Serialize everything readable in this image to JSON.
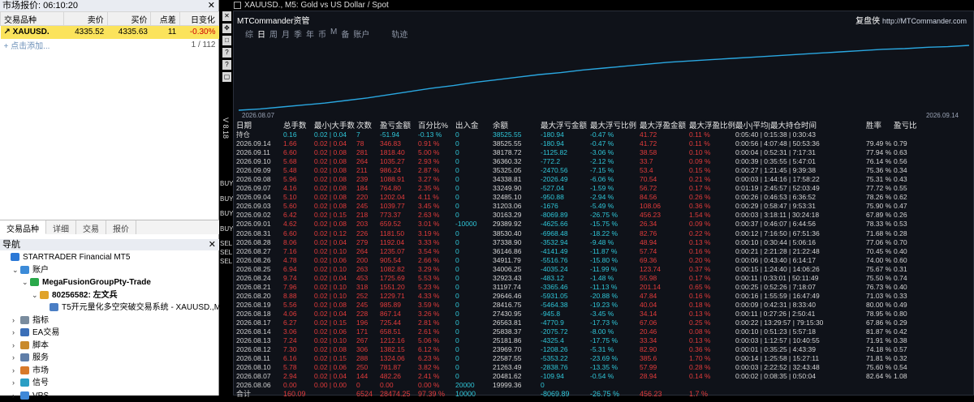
{
  "market_watch": {
    "title": "市场报价: 06:10:20",
    "columns": [
      "交易品种",
      "卖价",
      "买价",
      "点差",
      "日变化"
    ],
    "rows": [
      [
        "XAUUSD.",
        "4335.52",
        "4335.63",
        "11",
        "-0.30%"
      ]
    ],
    "add_label": "点击添加...",
    "count": "1 / 112"
  },
  "left_tabs": [
    "交易品种",
    "详细",
    "交易",
    "报价"
  ],
  "navigator": {
    "title": "导航",
    "items": [
      {
        "label": "STARTRADER Financial MT5",
        "level": 0,
        "icon": "#2b78d6",
        "bold": false
      },
      {
        "label": "账户",
        "level": 1,
        "icon": "#3c8bd8",
        "bold": false
      },
      {
        "label": "MegaFusionGroupPty-Trade",
        "level": 2,
        "icon": "#2aa84a",
        "bold": true
      },
      {
        "label": "80256582: 左文兵",
        "level": 3,
        "icon": "#e0a32a",
        "bold": true
      },
      {
        "label": "T5开元量化多空突破交易系统 - XAUUSD.,M",
        "level": 4,
        "icon": "#4a7ec4",
        "bold": false
      },
      {
        "label": "指标",
        "level": 1,
        "icon": "#7a8c9e",
        "bold": false
      },
      {
        "label": "EA交易",
        "level": 1,
        "icon": "#3b6fb8",
        "bold": false
      },
      {
        "label": "脚本",
        "level": 1,
        "icon": "#c98a2b",
        "bold": false
      },
      {
        "label": "服务",
        "level": 1,
        "icon": "#5f7ea8",
        "bold": false
      },
      {
        "label": "市场",
        "level": 1,
        "icon": "#d87a2a",
        "bold": false
      },
      {
        "label": "信号",
        "level": 1,
        "icon": "#2a9ec4",
        "bold": false
      },
      {
        "label": "VPS",
        "level": 1,
        "icon": "#3f88d8",
        "bold": false
      }
    ]
  },
  "chart_window": {
    "title": "XAUUSD., M5:  Gold vs US Dollar / Spot",
    "vertical_label": "V 8.18",
    "side_texts": [
      "BUY",
      "BUY",
      "BUY",
      "BUY",
      "SEL",
      "SEL",
      "SEL"
    ]
  },
  "panel": {
    "title": "MTCommander资管",
    "right_brand": "复盘侠",
    "right_url": "http://MTCommander.com",
    "tabs": [
      "综",
      "日",
      "周",
      "月",
      "季",
      "年",
      "币",
      "M",
      "备",
      "账户",
      "轨迹"
    ],
    "date_start": "2026.08.07",
    "date_end": "2026.09.14",
    "equity_curve": [
      0.0,
      0.02,
      0.05,
      0.08,
      0.11,
      0.15,
      0.19,
      0.24,
      0.29,
      0.34,
      0.38,
      0.43,
      0.47,
      0.51,
      0.55,
      0.58,
      0.62,
      0.65,
      0.68,
      0.71,
      0.74,
      0.76,
      0.78,
      0.8,
      0.82,
      0.84,
      0.86,
      0.88,
      0.9,
      0.92,
      0.94,
      0.95,
      0.97,
      0.98,
      1.0
    ],
    "headers": [
      "日期",
      "总手数",
      "最小|大手数",
      "次数",
      "盈亏金额",
      "百分比%",
      "出入金",
      "余额",
      "最大浮亏金额",
      "最大浮亏比例",
      "最大浮盈金额",
      "最大浮盈比例",
      "最小|平均|最大持仓时间",
      "胜率",
      "盈亏比"
    ],
    "hold_row": [
      "持仓",
      "0.16",
      "0.02 | 0.04",
      "7",
      "-51.94",
      "-0.13 %",
      "0",
      "38525.55",
      "-180.94",
      "-0.47 %",
      "41.72",
      "0.11 %",
      "0:05:40 | 0:15:38 | 0:30:43",
      "",
      ""
    ],
    "rows": [
      [
        "2026.09.14",
        "1.66",
        "0.02 | 0.04",
        "78",
        "346.83",
        "0.91 %",
        "0",
        "38525.55",
        "-180.94",
        "-0.47 %",
        "41.72",
        "0.11 %",
        "0:00:56 | 4:07:48 | 50:53:36",
        "79.49 %",
        "0.79"
      ],
      [
        "2026.09.11",
        "6.60",
        "0.02 | 0.08",
        "281",
        "1818.40",
        "5.00 %",
        "0",
        "38178.72",
        "-1125.82",
        "-3.06 %",
        "38.58",
        "0.10 %",
        "0:00:04 | 0:52:31 | 7:17:31",
        "77.94 %",
        "0.63"
      ],
      [
        "2026.09.10",
        "5.68",
        "0.02 | 0.08",
        "264",
        "1035.27",
        "2.93 %",
        "0",
        "36360.32",
        "-772.2",
        "-2.12 %",
        "33.7",
        "0.09 %",
        "0:00:39 | 0:35:55 | 5:47:01",
        "76.14 %",
        "0.56"
      ],
      [
        "2026.09.09",
        "5.48",
        "0.02 | 0.08",
        "211",
        "986.24",
        "2.87 %",
        "0",
        "35325.05",
        "-2470.56",
        "-7.15 %",
        "53.4",
        "0.15 %",
        "0:00:27 | 1:21:45 | 9:39:38",
        "75.36 %",
        "0.34"
      ],
      [
        "2026.09.08",
        "5.96",
        "0.02 | 0.08",
        "239",
        "1088.91",
        "3.27 %",
        "0",
        "34338.81",
        "-2026.49",
        "-6.06 %",
        "70.54",
        "0.21 %",
        "0:00:03 | 1:44:16 | 17:58:22",
        "75.31 %",
        "0.43"
      ],
      [
        "2026.09.07",
        "4.16",
        "0.02 | 0.08",
        "184",
        "764.80",
        "2.35 %",
        "0",
        "33249.90",
        "-527.04",
        "-1.59 %",
        "56.72",
        "0.17 %",
        "0:01:19 | 2:45:57 | 52:03:49",
        "77.72 %",
        "0.55"
      ],
      [
        "2026.09.04",
        "5.10",
        "0.02 | 0.08",
        "220",
        "1202.04",
        "4.11 %",
        "0",
        "32485.10",
        "-950.88",
        "-2.94 %",
        "84.56",
        "0.26 %",
        "0:00:26 | 0:46:53 | 6:36:52",
        "78.26 %",
        "0.62"
      ],
      [
        "2026.09.03",
        "5.60",
        "0.02 | 0.08",
        "245",
        "1039.77",
        "3.45 %",
        "0",
        "31203.06",
        "-1676",
        "-5.49 %",
        "108.06",
        "0.36 %",
        "0:00:29 | 0:58:47 | 9:53:31",
        "75.90 %",
        "0.47"
      ],
      [
        "2026.09.02",
        "6.42",
        "0.02 | 0.15",
        "218",
        "773.37",
        "2.63 %",
        "0",
        "30163.29",
        "-8069.89",
        "-26.75 %",
        "456.23",
        "1.54 %",
        "0:00:03 | 3:18:11 | 30:24:18",
        "67.89 %",
        "0.26"
      ],
      [
        "2026.09.01",
        "4.62",
        "0.02 | 0.08",
        "203",
        "659.52",
        "3.01 %",
        "-10000",
        "29389.92",
        "-4625.66",
        "-15.75 %",
        "26.34",
        "0.09 %",
        "0:00:37 | 0:46:07 | 6:44:56",
        "78.33 %",
        "0.53"
      ],
      [
        "2026.08.31",
        "6.60",
        "0.02 | 0.12",
        "226",
        "1181.50",
        "3.19 %",
        "0",
        "38530.40",
        "-6968.48",
        "-18.22 %",
        "82.76",
        "0.22 %",
        "0:00:12 | 7:16:50 | 67:51:36",
        "71.68 %",
        "0.28"
      ],
      [
        "2026.08.28",
        "8.06",
        "0.02 | 0.04",
        "279",
        "1192.04",
        "3.33 %",
        "0",
        "37338.90",
        "-3532.94",
        "-9.48 %",
        "48.94",
        "0.13 %",
        "0:00:10 | 0:30:44 | 5:06:16",
        "77.06 %",
        "0.70"
      ],
      [
        "2026.08.27",
        "7.16",
        "0.02 | 0.10",
        "264",
        "1235.07",
        "3.54 %",
        "0",
        "36146.86",
        "-4141.49",
        "-11.87 %",
        "57.74",
        "0.16 %",
        "0:00:21 | 2:21:28 | 21:22:48",
        "70.45 %",
        "0.40"
      ],
      [
        "2026.08.26",
        "4.78",
        "0.02 | 0.06",
        "200",
        "905.54",
        "2.66 %",
        "0",
        "34911.79",
        "-5516.76",
        "-15.80 %",
        "69.36",
        "0.20 %",
        "0:00:06 | 0:43:40 | 6:14:17",
        "74.00 %",
        "0.60"
      ],
      [
        "2026.08.25",
        "6.94",
        "0.02 | 0.10",
        "263",
        "1082.82",
        "3.29 %",
        "0",
        "34006.25",
        "-4035.24",
        "-11.99 %",
        "123.74",
        "0.37 %",
        "0:00:15 | 1:24:40 | 14:06:26",
        "75.67 %",
        "0.31"
      ],
      [
        "2026.08.24",
        "9.74",
        "0.02 | 0.04",
        "453",
        "1725.69",
        "5.53 %",
        "0",
        "32923.43",
        "-483.12",
        "-1.48 %",
        "55.98",
        "0.17 %",
        "0:00:11 | 0:33:01 | 50:11:49",
        "75.50 %",
        "0.74"
      ],
      [
        "2026.08.21",
        "7.96",
        "0.02 | 0.10",
        "318",
        "1551.20",
        "5.23 %",
        "0",
        "31197.74",
        "-3365.46",
        "-11.13 %",
        "201.14",
        "0.65 %",
        "0:00:25 | 0:52:26 | 7:18:07",
        "76.73 %",
        "0.40"
      ],
      [
        "2026.08.20",
        "8.88",
        "0.02 | 0.10",
        "252",
        "1229.71",
        "4.33 %",
        "0",
        "29646.46",
        "-5931.05",
        "-20.88 %",
        "47.84",
        "0.16 %",
        "0:00:16 | 1:55:59 | 16:47:49",
        "71.03 %",
        "0.33"
      ],
      [
        "2026.08.19",
        "5.56",
        "0.02 | 0.08",
        "245",
        "985.89",
        "3.59 %",
        "0",
        "28416.75",
        "-5464.38",
        "-19.23 %",
        "40.04",
        "0.18 %",
        "0:00:09 | 0:42:31 | 8:33:40",
        "80.00 %",
        "0.49"
      ],
      [
        "2026.08.18",
        "4.06",
        "0.02 | 0.04",
        "228",
        "867.14",
        "3.26 %",
        "0",
        "27430.95",
        "-945.8",
        "-3.45 %",
        "34.14",
        "0.13 %",
        "0:00:11 | 0:27:26 | 2:50:41",
        "78.95 %",
        "0.80"
      ],
      [
        "2026.08.17",
        "6.27",
        "0.02 | 0.15",
        "196",
        "725.44",
        "2.81 %",
        "0",
        "26563.81",
        "-4770.9",
        "-17.73 %",
        "67.06",
        "0.25 %",
        "0:00:22 | 13:29:57 | 79:15:30",
        "67.86 %",
        "0.29"
      ],
      [
        "2026.08.14",
        "3.06",
        "0.02 | 0.06",
        "171",
        "658.51",
        "2.61 %",
        "0",
        "25838.37",
        "-2075.72",
        "-8.00 %",
        "20.46",
        "0.08 %",
        "0:00:10 | 0:51:23 | 5:57:18",
        "81.87 %",
        "0.42"
      ],
      [
        "2026.08.13",
        "7.24",
        "0.02 | 0.10",
        "267",
        "1212.16",
        "5.06 %",
        "0",
        "25181.86",
        "-4325.4",
        "-17.75 %",
        "33.34",
        "0.13 %",
        "0:00:03 | 1:12:57 | 10:40:55",
        "71.91 %",
        "0.38"
      ],
      [
        "2026.08.12",
        "7.30",
        "0.02 | 0.08",
        "306",
        "1382.15",
        "6.12 %",
        "0",
        "23969.70",
        "-1208.26",
        "-5.31 %",
        "82.90",
        "0.36 %",
        "0:00:01 | 0:35:25 | 4:43:39",
        "74.18 %",
        "0.57"
      ],
      [
        "2026.08.11",
        "6.16",
        "0.02 | 0.15",
        "288",
        "1324.06",
        "6.23 %",
        "0",
        "22587.55",
        "-5353.22",
        "-23.69 %",
        "385.6",
        "1.70 %",
        "0:00:14 | 1:25:58 | 15:27:11",
        "71.81 %",
        "0.32"
      ],
      [
        "2026.08.10",
        "5.78",
        "0.02 | 0.06",
        "250",
        "781.87",
        "3.82 %",
        "0",
        "21263.49",
        "-2838.76",
        "-13.35 %",
        "57.99",
        "0.28 %",
        "0:00:03 | 2:22:52 | 32:43:48",
        "75.60 %",
        "0.54"
      ],
      [
        "2026.08.07",
        "2.94",
        "0.02 | 0.04",
        "144",
        "482.26",
        "2.41 %",
        "0",
        "20481.62",
        "-109.94",
        "-0.54 %",
        "28.94",
        "0.14 %",
        "0:00:02 | 0:08:35 | 0:50:04",
        "82.64 %",
        "1.08"
      ],
      [
        "2026.08.06",
        "0.00",
        "0.00 | 0.00",
        "0",
        "0.00",
        "0.00 %",
        "20000",
        "19999.36",
        "0",
        "",
        "",
        "",
        "",
        "",
        ""
      ]
    ],
    "total_row": [
      "合计",
      "160.09",
      "",
      "6524",
      "28474.25",
      "97.39 %",
      "10000",
      "",
      "-8069.89",
      "-26.75 %",
      "456.23",
      "1.7 %",
      "",
      "",
      ""
    ]
  }
}
